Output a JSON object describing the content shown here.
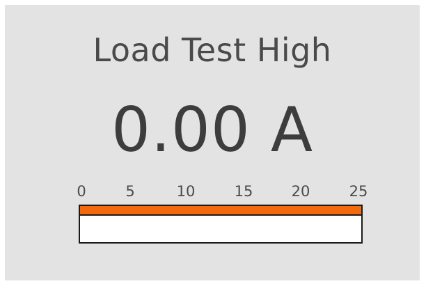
{
  "meter": {
    "title": "Load Test High",
    "reading": "0.00 A",
    "value": 0.0,
    "unit": "A"
  },
  "scale": {
    "min": 0,
    "max": 25,
    "ticks": [
      "0",
      "5",
      "10",
      "15",
      "20",
      "25"
    ]
  },
  "colors": {
    "panel_background": "#e3e3e3",
    "accent_band": "#f26a0c",
    "bar_background": "#ffffff",
    "text": "#4a4a4a"
  }
}
